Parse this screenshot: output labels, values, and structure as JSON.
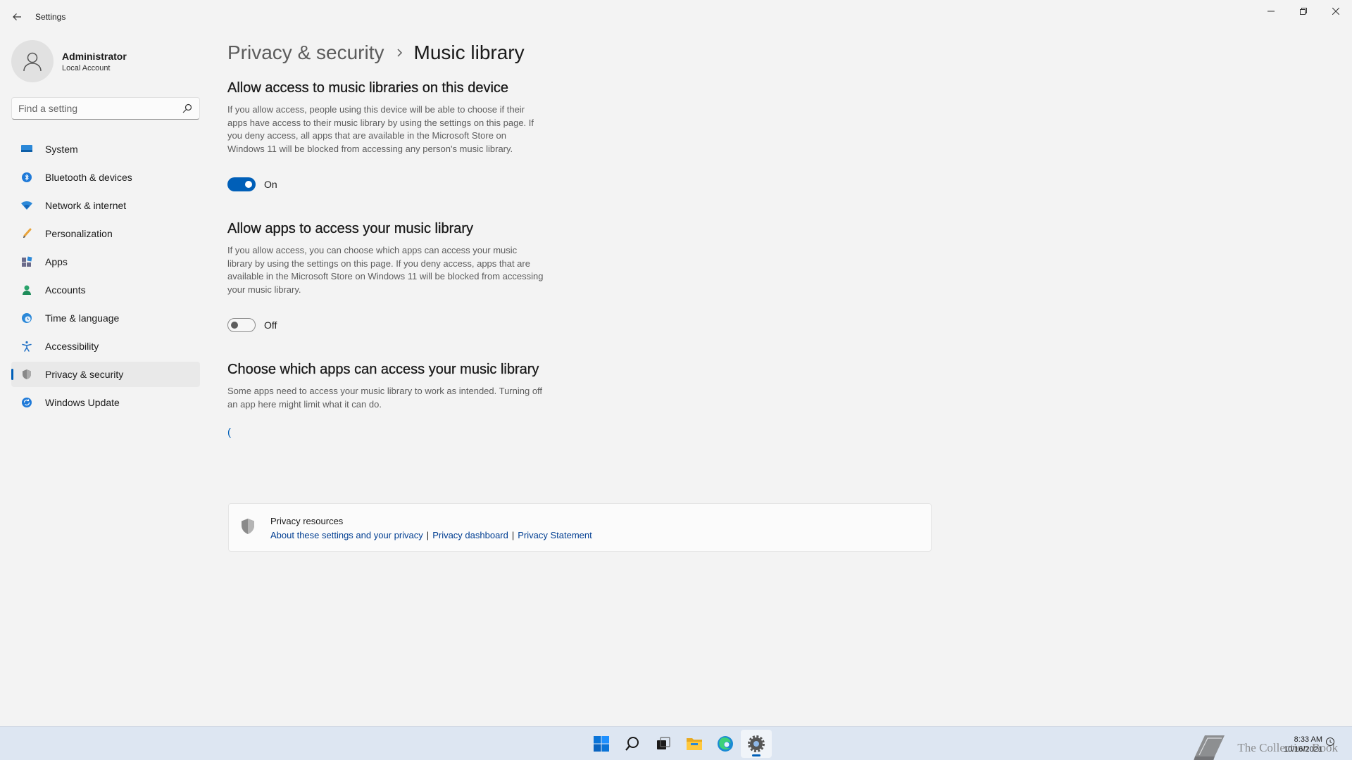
{
  "window": {
    "title": "Settings"
  },
  "user": {
    "name": "Administrator",
    "account_type": "Local Account"
  },
  "search": {
    "placeholder": "Find a setting"
  },
  "nav": [
    {
      "label": "System",
      "icon": "monitor-icon"
    },
    {
      "label": "Bluetooth & devices",
      "icon": "bluetooth-icon"
    },
    {
      "label": "Network & internet",
      "icon": "wifi-icon"
    },
    {
      "label": "Personalization",
      "icon": "brush-icon"
    },
    {
      "label": "Apps",
      "icon": "apps-icon"
    },
    {
      "label": "Accounts",
      "icon": "person-icon"
    },
    {
      "label": "Time & language",
      "icon": "globe-clock-icon"
    },
    {
      "label": "Accessibility",
      "icon": "accessibility-icon"
    },
    {
      "label": "Privacy & security",
      "icon": "shield-icon",
      "selected": true
    },
    {
      "label": "Windows Update",
      "icon": "update-icon"
    }
  ],
  "breadcrumb": {
    "parent": "Privacy & security",
    "current": "Music library"
  },
  "sections": {
    "device_access": {
      "title": "Allow access to music libraries on this device",
      "description": "If you allow access, people using this device will be able to choose if their apps have access to their music library by using the settings on this page. If you deny access, all apps that are available in the Microsoft Store on Windows 11 will be blocked from accessing any person's music library.",
      "toggle_state": "On"
    },
    "apps_access": {
      "title": "Allow apps to access your music library",
      "description": "If you allow access, you can choose which apps can access your music library by using the settings on this page. If you deny access, apps that are available in the Microsoft Store on Windows 11 will be blocked from accessing your music library.",
      "toggle_state": "Off"
    },
    "choose_apps": {
      "title": "Choose which apps can access your music library",
      "description": "Some apps need to access your music library to work as intended. Turning off an app here might limit what it can do.",
      "spinner_glyph": "("
    }
  },
  "privacy_resources": {
    "title": "Privacy resources",
    "links": [
      "About these settings and your privacy",
      "Privacy dashboard",
      "Privacy Statement"
    ],
    "separator": "|"
  },
  "taskbar": {
    "apps": [
      "start-icon",
      "search-icon",
      "task-view-icon",
      "file-explorer-icon",
      "edge-icon",
      "settings-icon"
    ],
    "active_app": "settings-icon",
    "watermark": "The Collection Book",
    "time": "8:33 AM",
    "date": "10/16/2021"
  },
  "colors": {
    "accent": "#005fb8",
    "background": "#f3f3f3",
    "taskbar": "#dde6f2",
    "link": "#003e92"
  }
}
